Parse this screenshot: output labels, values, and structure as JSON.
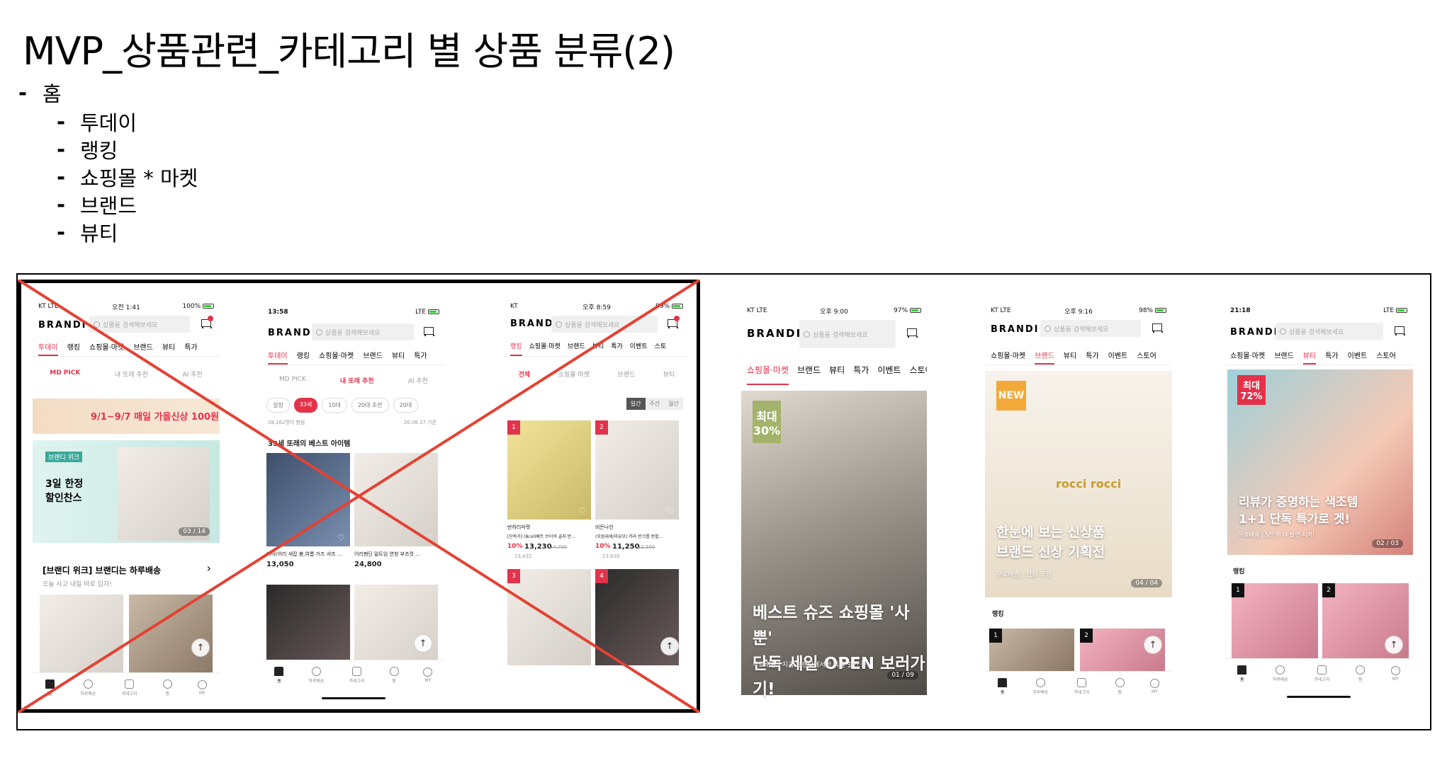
{
  "title": "MVP_상품관련_카테고리 별 상품 분류(2)",
  "outline": {
    "root": {
      "dash": "-",
      "label": "홈"
    },
    "items": [
      {
        "dash": "-",
        "label": "투데이"
      },
      {
        "dash": "-",
        "label": "랭킹"
      },
      {
        "dash": "-",
        "label": "쇼핑몰 * 마켓"
      },
      {
        "dash": "-",
        "label": "브랜드"
      },
      {
        "dash": "-",
        "label": "뷰티"
      }
    ]
  },
  "colors": {
    "accent": "#e3324a",
    "cross": "#e34234"
  },
  "brand": "BRANDI",
  "search_placeholder": "상품을 검색해보세요",
  "nav": [
    "홈",
    "하루배송",
    "카테고리",
    "찜",
    "MY"
  ],
  "scroll_up": "↑",
  "heart": "♡",
  "phones": [
    {
      "status": {
        "left": "KT LTE",
        "center": "오전 1:41",
        "right": "100%"
      },
      "tabs": [
        "투데이",
        "랭킹",
        "쇼핑몰·마켓",
        "브랜드",
        "뷰티",
        "특가"
      ],
      "subtabs": [
        "MD PICK",
        "내 또래 추천",
        "AI 추천"
      ],
      "banner_top": "9/1~9/7 매일 가을신상 100원!",
      "banner_tag": "브랜디 위크",
      "banner_main": "3일 한정\n할인찬스",
      "banner_counter": "03 / 14",
      "section_title": "[브랜디 위크] 브랜디는 하루배송",
      "section_sub": "오늘 사고 내일 바로 입자!",
      "chevron": "›"
    },
    {
      "status": {
        "left": "13:58",
        "right": "LTE"
      },
      "tabs": [
        "투데이",
        "랭킹",
        "쇼핑몰·마켓",
        "브랜드",
        "뷰티",
        "특가"
      ],
      "subtabs": [
        "MD PICK",
        "내 또래 추천",
        "AI 추천"
      ],
      "age_chips": [
        "설정",
        "33세",
        "10대",
        "20대 초반",
        "20대"
      ],
      "meta_left": "28,162명이 봤음",
      "meta_right": "20.08.17 기준",
      "section_title": "33세 또래의 베스트 아이템",
      "products": [
        {
          "name": "미아(어리 세잡 봄,여름 거즈 셔츠 ...",
          "price": "13,050"
        },
        {
          "name": "어리펜딘 밑트임 연청 부츠컷 ...",
          "price": "24,800"
        }
      ]
    },
    {
      "status": {
        "left": "KT",
        "center": "오후 8:59",
        "right": "99%"
      },
      "tabs": [
        "랭킹",
        "쇼핑몰·마켓",
        "브랜드",
        "뷰티",
        "특가",
        "이벤트",
        "스토"
      ],
      "subtabs": [
        "전체",
        "쇼핑몰·마켓",
        "브랜드",
        "뷰티"
      ],
      "period": [
        "일간",
        "주간",
        "월간"
      ],
      "products": [
        {
          "rank": "1",
          "shop": "반하리마켓",
          "name": "[단독가] (8col)베트 브이넥 골지 반...",
          "discount": "10%",
          "price": "13,230",
          "orig": "14,700",
          "likes": "13,432"
        },
        {
          "rank": "2",
          "shop": "비든나인",
          "name": "(모듬대세/미유모) 카라 반크롭 반팔...",
          "discount": "10%",
          "price": "11,250",
          "orig": "12,500",
          "likes": "23,630"
        },
        {
          "rank": "3"
        },
        {
          "rank": "4"
        }
      ]
    },
    {
      "status": {
        "left": "KT LTE",
        "center": "오후 9:00",
        "right": "97%"
      },
      "tabs": [
        "쇼핑몰·마켓",
        "브랜드",
        "뷰티",
        "특가",
        "이벤트",
        "스토어"
      ],
      "tag": "최대\n30%",
      "headline": "베스트 슈즈 쇼핑몰 '사뿐'\n단독 세일 OPEN 보러가기!",
      "caption": "무료배송 | 지금 브랜디에서만 특별 할인 중",
      "counter": "01 / 09"
    },
    {
      "status": {
        "left": "KT LTE",
        "center": "오후 9:16",
        "right": "98%"
      },
      "tabs": [
        "쇼핑몰·마켓",
        "브랜드",
        "뷰티",
        "특가",
        "이벤트",
        "스토어"
      ],
      "tag": "NEW",
      "shirt": "rocci rocci",
      "headline": "한눈에 보는 신상품\n브랜드 신상 기획전",
      "caption": "무료배송 | 신상 모음",
      "counter": "04 / 04",
      "section": "랭킹",
      "ranks": [
        "1",
        "2"
      ]
    },
    {
      "status": {
        "left": "21:18",
        "right": "LTE"
      },
      "tabs": [
        "쇼핑몰·마켓",
        "브랜드",
        "뷰티",
        "특가",
        "이벤트",
        "스토어"
      ],
      "tag": "최대\n72%",
      "headline": "리뷰가 증명하는 색조템\n1+1 단독 특가로 겟!",
      "caption": "무료배송 | 5천 원 다 팔면 시작!",
      "counter": "02 / 03",
      "section": "랭킹",
      "ranks": [
        "1",
        "2"
      ]
    }
  ]
}
